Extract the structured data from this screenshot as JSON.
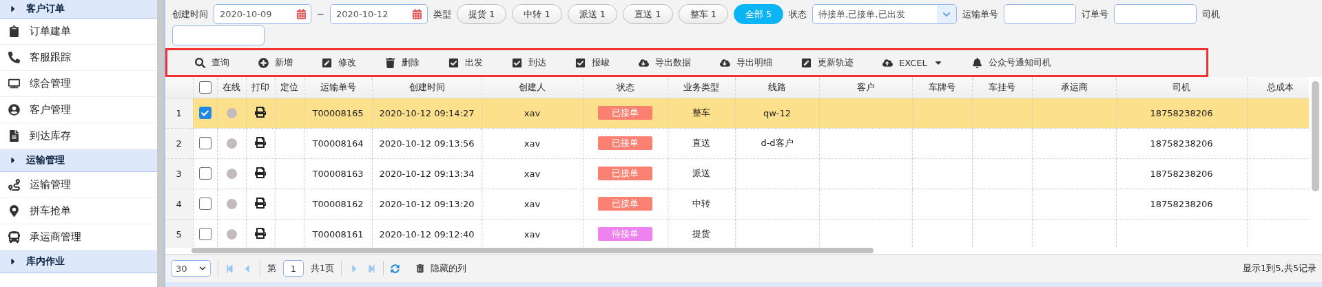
{
  "sidebar": {
    "groups": [
      {
        "label": "客户订单",
        "items": [
          {
            "label": "订单建单"
          },
          {
            "label": "客服跟踪"
          },
          {
            "label": "综合管理"
          },
          {
            "label": "客户管理"
          },
          {
            "label": "到达库存"
          }
        ]
      },
      {
        "label": "运输管理",
        "items": [
          {
            "label": "运输管理"
          },
          {
            "label": "拼车抢单"
          },
          {
            "label": "承运商管理"
          }
        ]
      },
      {
        "label": "库内作业"
      }
    ]
  },
  "filters": {
    "created_label": "创建时间",
    "date_from": "2020-10-09",
    "range_sep": "~",
    "date_to": "2020-10-12",
    "type_label": "类型",
    "type_pills": [
      {
        "label": "提货 1",
        "selected": false
      },
      {
        "label": "中转 1",
        "selected": false
      },
      {
        "label": "派送 1",
        "selected": false
      },
      {
        "label": "直送 1",
        "selected": false
      },
      {
        "label": "整车 1",
        "selected": false
      },
      {
        "label": "全部 5",
        "selected": true
      }
    ],
    "status_label": "状态",
    "status_value": "待接单,已接单,已出发",
    "waybill_label": "运输单号",
    "order_label": "订单号",
    "driver_label": "司机"
  },
  "toolbar": [
    {
      "label": "查询",
      "kind": "button"
    },
    {
      "label": "新增",
      "kind": "button"
    },
    {
      "label": "修改",
      "kind": "button"
    },
    {
      "label": "删除",
      "kind": "button"
    },
    {
      "label": "出发",
      "kind": "button"
    },
    {
      "label": "到达",
      "kind": "button"
    },
    {
      "label": "报峻",
      "kind": "button"
    },
    {
      "label": "导出数据",
      "kind": "button"
    },
    {
      "label": "导出明细",
      "kind": "button"
    },
    {
      "label": "更新轨迹",
      "kind": "button"
    },
    {
      "label": "EXCEL",
      "kind": "dropdown"
    },
    {
      "label": "公众号通知司机",
      "kind": "button"
    }
  ],
  "table": {
    "select_all_checked": false,
    "columns": [
      "在线",
      "打印",
      "定位",
      "运输单号",
      "创建时间",
      "创建人",
      "状态",
      "业务类型",
      "线路",
      "客户",
      "车牌号",
      "车挂号",
      "承运商",
      "司机",
      "总成本"
    ],
    "rows": [
      {
        "index": "1",
        "selected": true,
        "checked": true,
        "online": false,
        "waybill": "T00008165",
        "created": "2020-10-12 09:14:27",
        "creator": "xav",
        "status": "已接单",
        "color": "#fa8072",
        "business_type": "整车",
        "route": "qw-12",
        "driver": "18758238206"
      },
      {
        "index": "2",
        "selected": false,
        "checked": false,
        "online": false,
        "waybill": "T00008164",
        "created": "2020-10-12 09:13:56",
        "creator": "xav",
        "status": "已接单",
        "color": "#fa8072",
        "business_type": "直送",
        "route": "d-d客户",
        "driver": "18758238206"
      },
      {
        "index": "3",
        "selected": false,
        "checked": false,
        "online": false,
        "waybill": "T00008163",
        "created": "2020-10-12 09:13:34",
        "creator": "xav",
        "status": "已接单",
        "color": "#fa8072",
        "business_type": "派送",
        "driver": "18758238206"
      },
      {
        "index": "4",
        "selected": false,
        "checked": false,
        "online": false,
        "waybill": "T00008162",
        "created": "2020-10-12 09:13:20",
        "creator": "xav",
        "status": "已接单",
        "color": "#fa8072",
        "business_type": "中转",
        "driver": "18758238206"
      },
      {
        "index": "5",
        "selected": false,
        "checked": false,
        "online": false,
        "waybill": "T00008161",
        "created": "2020-10-12 09:12:40",
        "creator": "xav",
        "status": "待接单",
        "color": "#ee82ee",
        "business_type": "提货"
      }
    ]
  },
  "pager": {
    "page_size": "30",
    "page_label_before": "第",
    "page": "1",
    "page_label_after": "共1页",
    "hidden_columns": "隐藏的列",
    "summary": "显示1到5,共5记录"
  }
}
